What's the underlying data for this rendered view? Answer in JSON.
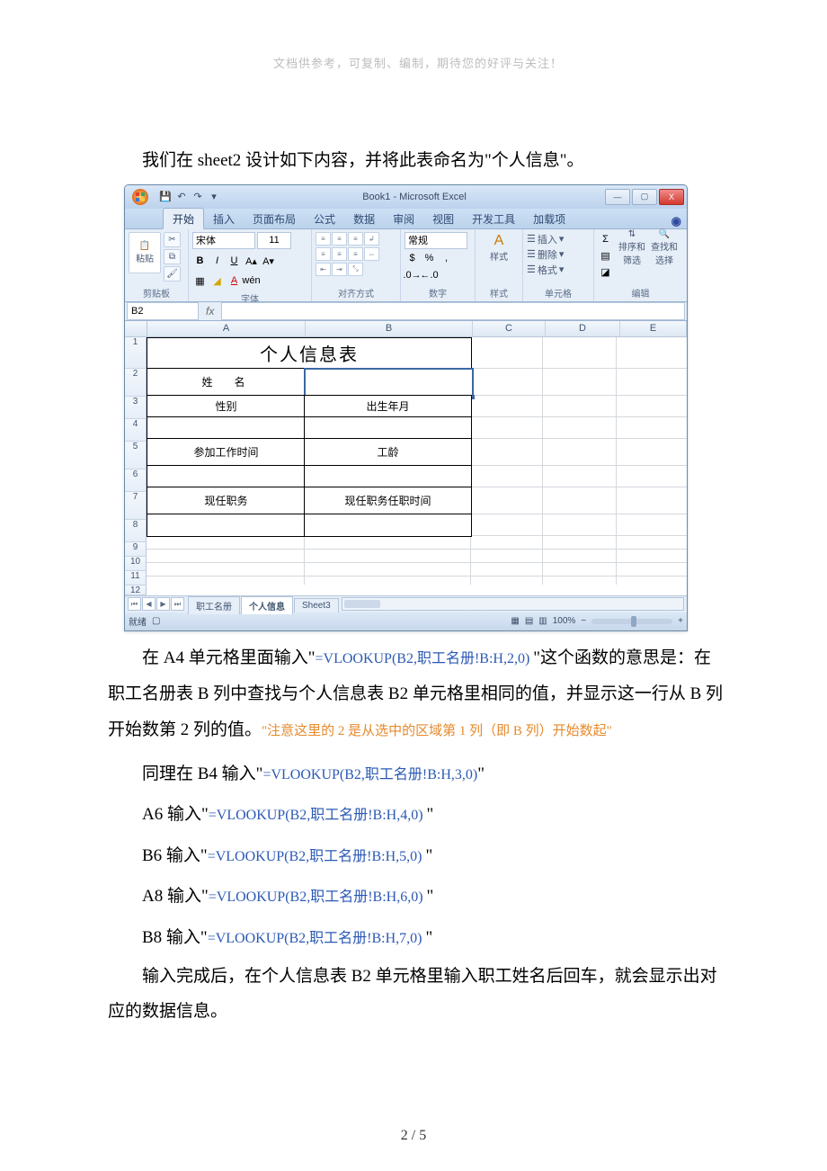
{
  "header_note": "文档供参考，可复制、编制，期待您的好评与关注！",
  "intro_para": "我们在 sheet2 设计如下内容，并将此表命名为\"个人信息\"。",
  "excel": {
    "title": "Book1 - Microsoft Excel",
    "qat": {
      "save": "💾",
      "undo": "↶",
      "redo": "↷"
    },
    "winbtns": {
      "min": "—",
      "max": "▢",
      "close": "X"
    },
    "tabs": {
      "home": "开始",
      "insert": "插入",
      "layout": "页面布局",
      "formula": "公式",
      "data": "数据",
      "review": "审阅",
      "view": "视图",
      "dev": "开发工具",
      "addin": "加载项"
    },
    "groups": {
      "clipboard_label": "剪贴板",
      "paste": "粘贴",
      "font_label": "字体",
      "font_name": "宋体",
      "font_size": "11",
      "align_label": "对齐方式",
      "number_label": "数字",
      "number_format": "常规",
      "style_label": "样式",
      "style_btn": "样式",
      "cells_label": "单元格",
      "insert_btn": "插入",
      "delete_btn": "删除",
      "format_btn": "格式",
      "edit_label": "编辑",
      "sort": "排序和\n筛选",
      "find": "查找和\n选择"
    },
    "namebox": "B2",
    "columns": {
      "A": "A",
      "B": "B",
      "C": "C",
      "D": "D",
      "E": "E"
    },
    "rows": [
      "1",
      "2",
      "3",
      "4",
      "5",
      "6",
      "7",
      "8",
      "9",
      "10",
      "11",
      "12"
    ],
    "sheet": {
      "title_cell": "个人信息表",
      "a2": "姓　名",
      "a3": "性别",
      "b3": "出生年月",
      "a5": "参加工作时间",
      "b5": "工龄",
      "a7": "现任职务",
      "b7": "现任职务任职时间"
    },
    "sheettabs": {
      "s1": "职工名册",
      "s2": "个人信息",
      "s3": "Sheet3"
    },
    "status": {
      "ready": "就绪",
      "zoom": "100%"
    }
  },
  "para2_pre": "在 A4 单元格里面输入\"",
  "para2_code": "=VLOOKUP(B2,职工名册!B:H,2,0) ",
  "para2_post": "\"这个函数的意思是：在职工名册表 B 列中查找与个人信息表 B2 单元格里相同的值，并显示这一行从 B 列开始数第 2 列的值。",
  "note_orange": "\"注意这里的 2 是从选中的区域第 1 列（即 B 列）开始数起\"",
  "lines": [
    {
      "pre": "同理在 B4 输入\"",
      "code": "=VLOOKUP(B2,职工名册!B:H,3,0)",
      "post": "\""
    },
    {
      "pre": "A6 输入\"",
      "code": "=VLOOKUP(B2,职工名册!B:H,4,0) ",
      "post": "\""
    },
    {
      "pre": "B6 输入\"",
      "code": "=VLOOKUP(B2,职工名册!B:H,5,0) ",
      "post": "\""
    },
    {
      "pre": "A8 输入\"",
      "code": "=VLOOKUP(B2,职工名册!B:H,6,0) ",
      "post": "\""
    },
    {
      "pre": "B8 输入\"",
      "code": "=VLOOKUP(B2,职工名册!B:H,7,0) ",
      "post": "\""
    }
  ],
  "final_para": "输入完成后，在个人信息表 B2 单元格里输入职工姓名后回车，就会显示出对应的数据信息。",
  "page_num": "2 / 5"
}
